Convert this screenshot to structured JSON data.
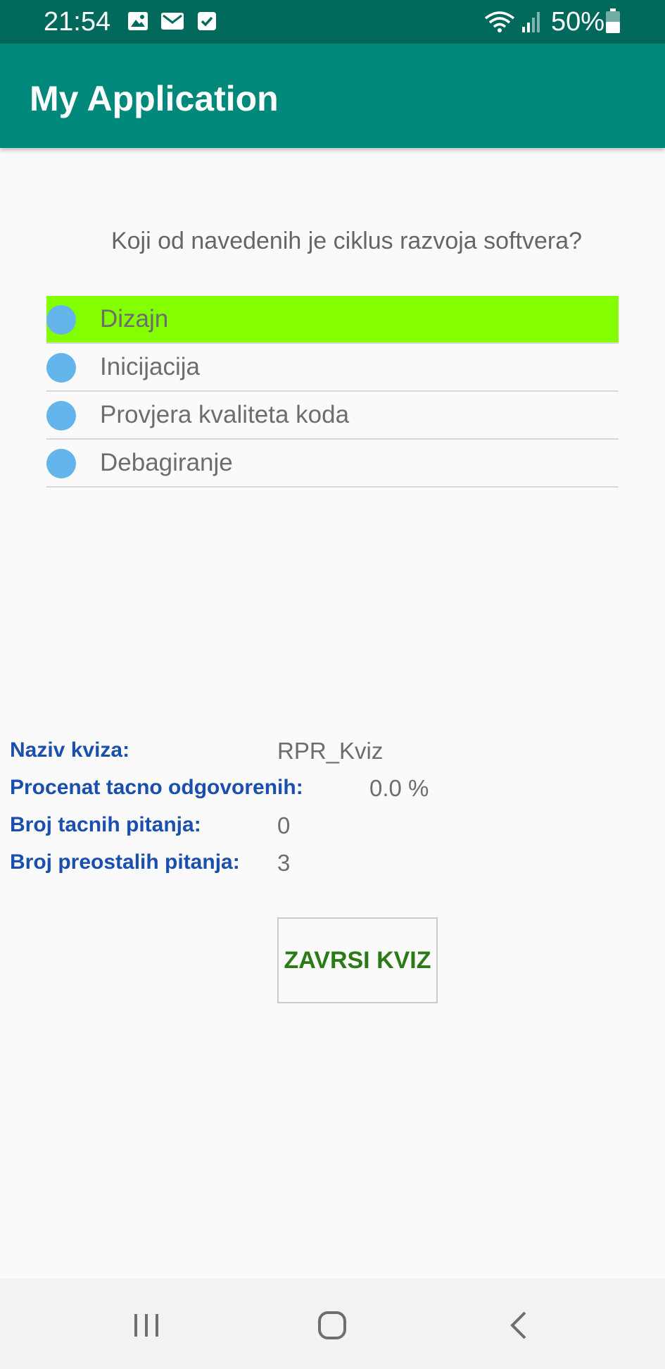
{
  "status_bar": {
    "time": "21:54",
    "battery_percent": "50%",
    "icons": [
      "image-icon",
      "mail-icon",
      "check-box-icon",
      "wifi-icon",
      "signal-icon",
      "battery-icon"
    ]
  },
  "app_bar": {
    "title": "My Application"
  },
  "question": {
    "text": "Koji od navedenih je ciklus razvoja softvera?",
    "answers": [
      {
        "label": "Dizajn",
        "selected": true
      },
      {
        "label": "Inicijacija",
        "selected": false
      },
      {
        "label": "Provjera kvaliteta koda",
        "selected": false
      },
      {
        "label": "Debagiranje",
        "selected": false
      }
    ]
  },
  "quiz_info": {
    "name_label": "Naziv kviza:",
    "name_value": "RPR_Kviz",
    "percent_label": "Procenat tacno odgovorenih:",
    "percent_value": "0.0 %",
    "correct_label": "Broj tacnih pitanja:",
    "correct_value": "0",
    "remaining_label": "Broj preostalih pitanja:",
    "remaining_value": "3"
  },
  "finish_button": {
    "label": "ZAVRSI KVIZ"
  },
  "nav_bar": {
    "buttons": [
      "recent-apps-icon",
      "home-icon",
      "back-icon"
    ]
  },
  "colors": {
    "status_bar": "#00695c",
    "app_bar": "#00897b",
    "selected_answer": "#84ff00",
    "radio_dot": "#64b5ec",
    "info_label": "#1a4fae",
    "button_text": "#2c7a16"
  }
}
